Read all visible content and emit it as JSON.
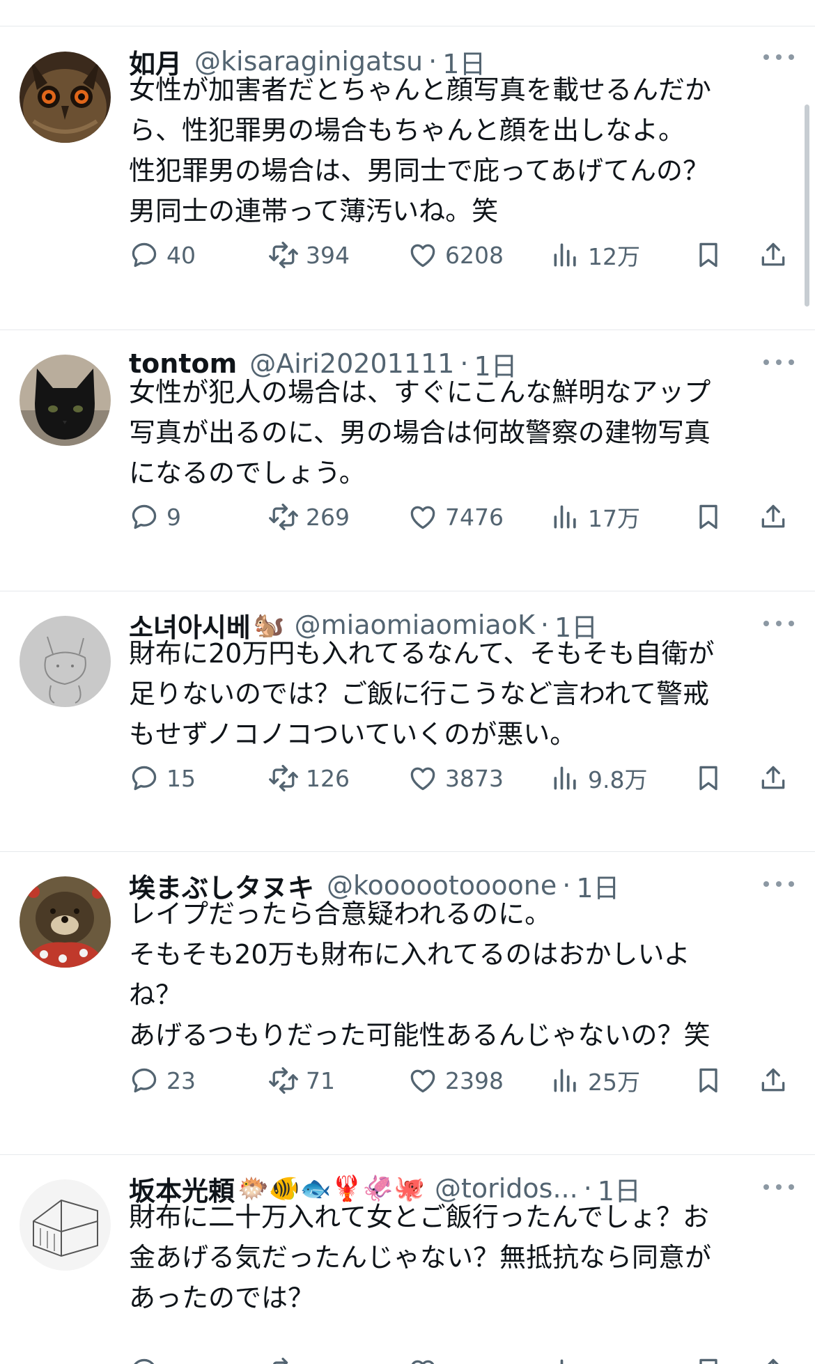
{
  "posts": [
    {
      "name": "如月",
      "emojis": "",
      "handle": "@kisaraginigatsu",
      "time": "1日",
      "lines": [
        "女性が加害者だとちゃんと顔写真を載せるんだか",
        "ら、性犯罪男の場合もちゃんと顔を出しなよ。",
        "性犯罪男の場合は、男同士で庇ってあげてんの？",
        "男同士の連帯って薄汚いね。笑"
      ],
      "replies": "40",
      "reposts": "394",
      "likes": "6208",
      "views": "12万"
    },
    {
      "name": "tontom",
      "emojis": "",
      "handle": "@Airi20201111",
      "time": "1日",
      "lines": [
        "女性が犯人の場合は、すぐにこんな鮮明なアップ",
        "写真が出るのに、男の場合は何故警察の建物写真",
        "になるのでしょう。"
      ],
      "replies": "9",
      "reposts": "269",
      "likes": "7476",
      "views": "17万"
    },
    {
      "name": "소녀아시베",
      "emojis": "🐿️",
      "handle": "@miaomiaomiaoK",
      "time": "1日",
      "lines": [
        "財布に20万円も入れてるなんて、そもそも自衛が",
        "足りないのでは？ご飯に行こうなど言われて警戒",
        "もせずノコノコついていくのが悪い。"
      ],
      "replies": "15",
      "reposts": "126",
      "likes": "3873",
      "views": "9.8万"
    },
    {
      "name": "埃まぶしタヌキ",
      "emojis": "",
      "handle": "@koooootoooone",
      "time": "1日",
      "lines": [
        "レイプだったら合意疑われるのに。",
        "そもそも20万も財布に入れてるのはおかしいよ",
        "ね？",
        "あげるつもりだった可能性あるんじゃないの？笑"
      ],
      "replies": "23",
      "reposts": "71",
      "likes": "2398",
      "views": "25万"
    },
    {
      "name": "坂本光頼",
      "emojis": "🐡🐠🐟🦞🦑🐙",
      "handle": "@toridos...",
      "time": "1日",
      "lines": [
        "財布に二十万入れて女とご飯行ったんでしょ？お",
        "金あげる気だったんじゃない？無抵抗なら同意が",
        "あったのでは？"
      ],
      "replies": "",
      "reposts": "",
      "likes": "",
      "views": ""
    }
  ],
  "colors": {
    "text": "#0f1419",
    "secondary": "#536471",
    "divider": "#e6e9ec"
  },
  "icons": [
    "reply-icon",
    "repost-icon",
    "like-icon",
    "views-icon",
    "bookmark-icon",
    "share-icon",
    "more-icon"
  ]
}
